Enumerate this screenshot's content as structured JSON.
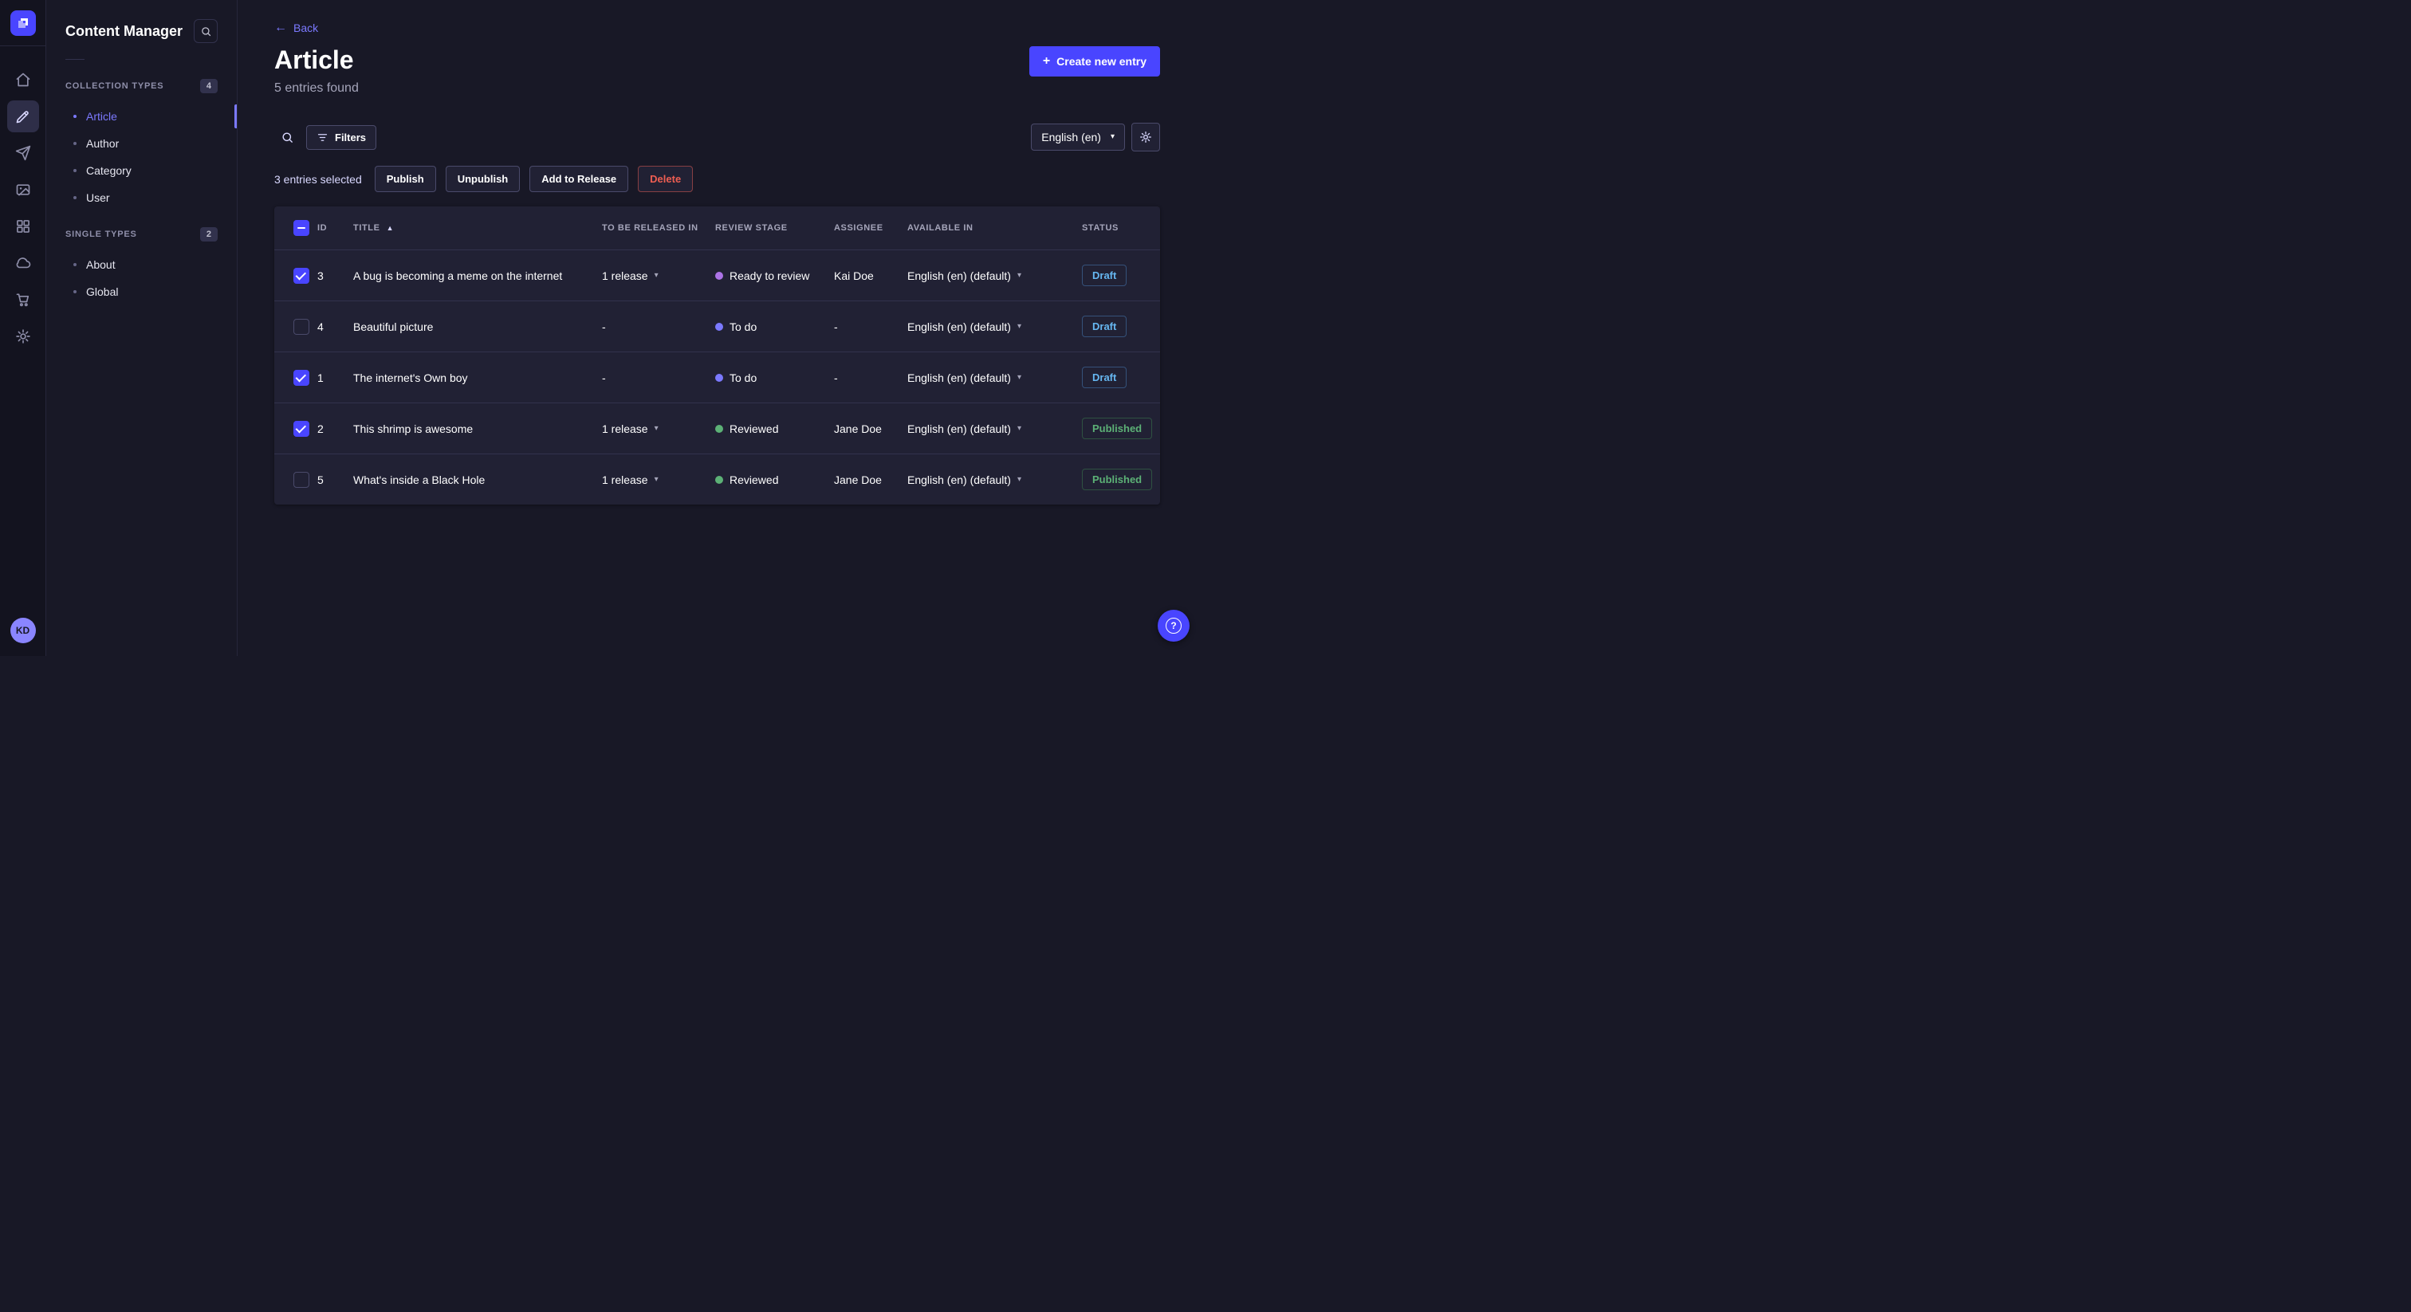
{
  "nav_rail": {
    "logo_icon": "strapi-logo",
    "items": [
      {
        "icon": "home-icon",
        "active": false
      },
      {
        "icon": "content-manager-pen-icon",
        "active": true
      },
      {
        "icon": "paper-plane-icon",
        "active": false
      },
      {
        "icon": "media-library-icon",
        "active": false
      },
      {
        "icon": "content-type-builder-icon",
        "active": false
      },
      {
        "icon": "cloud-icon",
        "active": false
      },
      {
        "icon": "marketplace-cart-icon",
        "active": false
      },
      {
        "icon": "settings-gear-icon",
        "active": false
      }
    ],
    "avatar_initials": "KD"
  },
  "sidebar": {
    "title": "Content Manager",
    "sections": [
      {
        "label": "COLLECTION TYPES",
        "badge": "4",
        "items": [
          {
            "label": "Article",
            "active": true
          },
          {
            "label": "Author",
            "active": false
          },
          {
            "label": "Category",
            "active": false
          },
          {
            "label": "User",
            "active": false
          }
        ]
      },
      {
        "label": "SINGLE TYPES",
        "badge": "2",
        "items": [
          {
            "label": "About",
            "active": false
          },
          {
            "label": "Global",
            "active": false
          }
        ]
      }
    ]
  },
  "header": {
    "back_label": "Back",
    "title": "Article",
    "subtitle": "5 entries found",
    "create_button_label": "Create new entry"
  },
  "toolbar": {
    "filters_label": "Filters",
    "locale_value": "English (en)"
  },
  "selection": {
    "text": "3 entries selected",
    "publish_label": "Publish",
    "unpublish_label": "Unpublish",
    "add_to_release_label": "Add to Release",
    "delete_label": "Delete"
  },
  "table": {
    "select_all_state": "indeterminate",
    "sorted_column": "TITLE",
    "sort_direction": "asc",
    "columns": [
      "ID",
      "TITLE",
      "TO BE RELEASED IN",
      "REVIEW STAGE",
      "ASSIGNEE",
      "AVAILABLE IN",
      "STATUS"
    ],
    "status_colors": {
      "Draft": {
        "text": "#66b7f1",
        "border": "#35517a"
      },
      "Published": {
        "text": "#5cb176",
        "border": "#2f5241"
      }
    },
    "rows": [
      {
        "checked": true,
        "id": "3",
        "title": "A bug is becoming a meme on the internet",
        "release": "1 release",
        "release_dropdown": true,
        "stage": "Ready to review",
        "stage_color": "#ac73e6",
        "assignee": "Kai Doe",
        "locale": "English (en) (default)",
        "status": "Draft"
      },
      {
        "checked": false,
        "id": "4",
        "title": "Beautiful picture",
        "release": "-",
        "release_dropdown": false,
        "stage": "To do",
        "stage_color": "#7b79ff",
        "assignee": "-",
        "locale": "English (en) (default)",
        "status": "Draft"
      },
      {
        "checked": true,
        "id": "1",
        "title": "The internet's Own boy",
        "release": "-",
        "release_dropdown": false,
        "stage": "To do",
        "stage_color": "#7b79ff",
        "assignee": "-",
        "locale": "English (en) (default)",
        "status": "Draft"
      },
      {
        "checked": true,
        "id": "2",
        "title": "This shrimp is awesome",
        "release": "1 release",
        "release_dropdown": true,
        "stage": "Reviewed",
        "stage_color": "#5cb176",
        "assignee": "Jane Doe",
        "locale": "English (en) (default)",
        "status": "Published"
      },
      {
        "checked": false,
        "id": "5",
        "title": "What's inside a Black Hole",
        "release": "1 release",
        "release_dropdown": true,
        "stage": "Reviewed",
        "stage_color": "#5cb176",
        "assignee": "Jane Doe",
        "locale": "English (en) (default)",
        "status": "Published"
      }
    ]
  },
  "colors": {
    "accent": "#4945ff",
    "accent_light": "#7b79ff",
    "danger": "#ee5e52"
  },
  "help_button": {
    "icon": "help-icon"
  }
}
